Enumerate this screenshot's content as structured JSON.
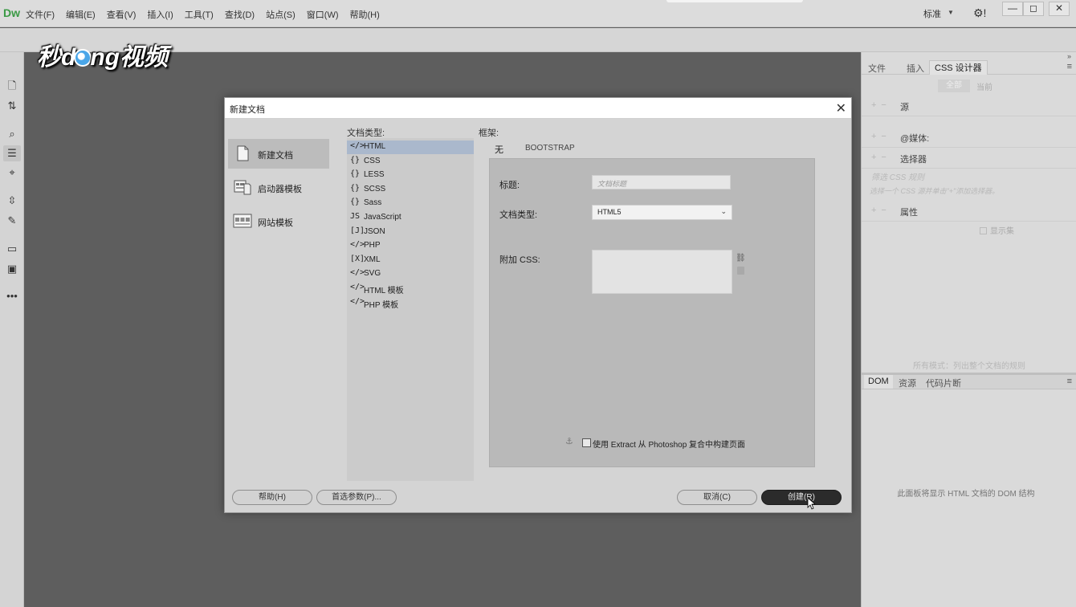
{
  "app": {
    "logo": "Dw"
  },
  "menubar": {
    "items": [
      "文件(F)",
      "编辑(E)",
      "查看(V)",
      "插入(I)",
      "工具(T)",
      "查找(D)",
      "站点(S)",
      "窗口(W)",
      "帮助(H)"
    ],
    "workspace": "标准",
    "window_buttons": [
      "—",
      "◻",
      "✕"
    ]
  },
  "watermark": {
    "left": "秒d",
    "right": "ng视频"
  },
  "left_toolbar": {
    "icons": [
      "file-icon",
      "sort-icon",
      "inspect-icon",
      "code-nav-icon",
      "target-icon",
      "expand-icon",
      "brush-icon",
      "comment-icon",
      "image-icon",
      "more-icon"
    ]
  },
  "right_panel": {
    "tabs": [
      "文件",
      "插入",
      "CSS 设计器"
    ],
    "css_all": "全部",
    "css_current": "当前",
    "sections": [
      "源",
      "@媒体:",
      "选择器",
      "属性"
    ],
    "selector_filter": "筛选 CSS 规则",
    "selector_hint": "选择一个 CSS 源并单击\"+\"添加选择器。",
    "show_set": "显示集",
    "footer": "所有模式：列出整个文档的规则",
    "dom_tabs": [
      "DOM",
      "资源",
      "代码片断"
    ],
    "dom_message": "此面板将显示 HTML 文档的 DOM 结构"
  },
  "dialog": {
    "title": "新建文档",
    "categories": [
      "新建文档",
      "启动器模板",
      "网站模板"
    ],
    "doctype_label": "文档类型:",
    "doctypes": [
      {
        "icon": "</>",
        "label": "HTML"
      },
      {
        "icon": "{}",
        "label": "CSS"
      },
      {
        "icon": "{}",
        "label": "LESS"
      },
      {
        "icon": "{}",
        "label": "SCSS"
      },
      {
        "icon": "{}",
        "label": "Sass"
      },
      {
        "icon": "JS",
        "label": "JavaScript"
      },
      {
        "icon": "[J]",
        "label": "JSON"
      },
      {
        "icon": "</>",
        "label": "PHP"
      },
      {
        "icon": "[X]",
        "label": "XML"
      },
      {
        "icon": "</>",
        "label": "SVG"
      },
      {
        "icon": "</>",
        "label": "HTML 模板"
      },
      {
        "icon": "</>",
        "label": "PHP 模板"
      }
    ],
    "framework_label": "框架:",
    "framework_tabs": [
      "无",
      "BOOTSTRAP"
    ],
    "title_label": "标题:",
    "title_placeholder": "文档标题",
    "doctype_field_label": "文档类型:",
    "doctype_value": "HTML5",
    "attach_css_label": "附加 CSS:",
    "extract_label": "使用 Extract 从 Photoshop 复合中构建页面",
    "help_button": "帮助(H)",
    "prefs_button": "首选参数(P)...",
    "cancel_button": "取消(C)",
    "create_button": "创建(R)"
  }
}
